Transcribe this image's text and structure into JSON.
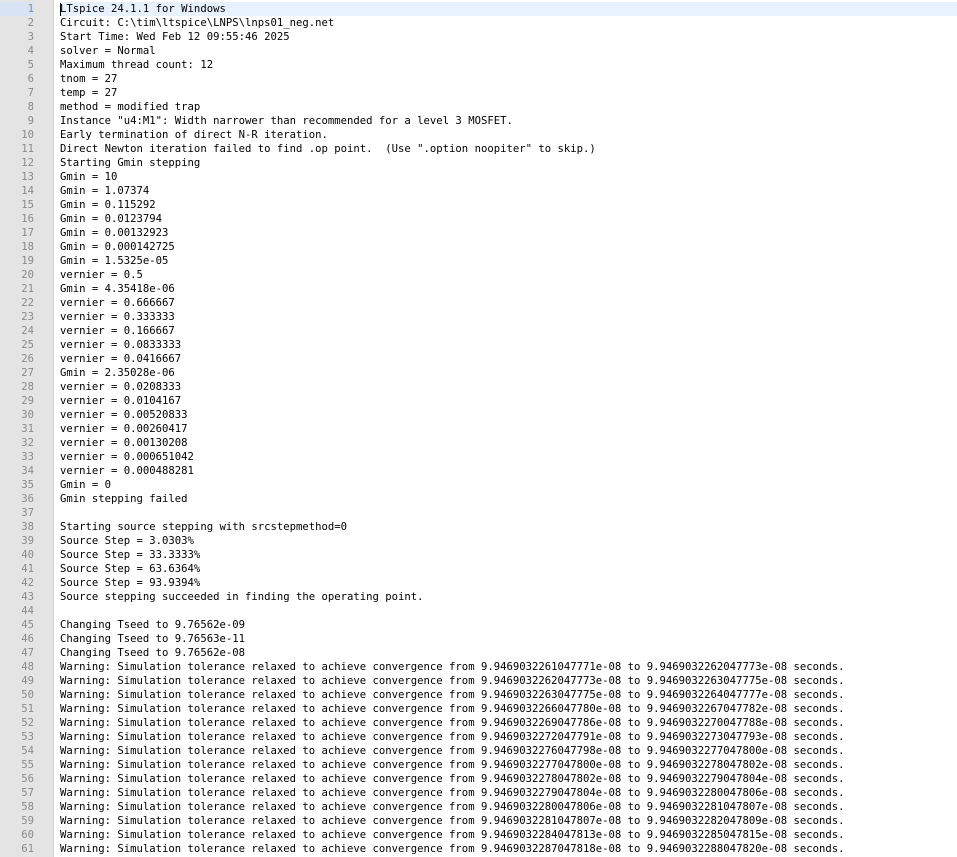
{
  "log": {
    "lines": [
      "LTspice 24.1.1 for Windows",
      "Circuit: C:\\tim\\ltspice\\LNPS\\lnps01_neg.net",
      "Start Time: Wed Feb 12 09:55:46 2025",
      "solver = Normal",
      "Maximum thread count: 12",
      "tnom = 27",
      "temp = 27",
      "method = modified trap",
      "Instance \"u4:M1\": Width narrower than recommended for a level 3 MOSFET.",
      "Early termination of direct N-R iteration.",
      "Direct Newton iteration failed to find .op point.  (Use \".option noopiter\" to skip.)",
      "Starting Gmin stepping",
      "Gmin = 10",
      "Gmin = 1.07374",
      "Gmin = 0.115292",
      "Gmin = 0.0123794",
      "Gmin = 0.00132923",
      "Gmin = 0.000142725",
      "Gmin = 1.5325e-05",
      "vernier = 0.5",
      "Gmin = 4.35418e-06",
      "vernier = 0.666667",
      "vernier = 0.333333",
      "vernier = 0.166667",
      "vernier = 0.0833333",
      "vernier = 0.0416667",
      "Gmin = 2.35028e-06",
      "vernier = 0.0208333",
      "vernier = 0.0104167",
      "vernier = 0.00520833",
      "vernier = 0.00260417",
      "vernier = 0.00130208",
      "vernier = 0.000651042",
      "vernier = 0.000488281",
      "Gmin = 0",
      "Gmin stepping failed",
      "",
      "Starting source stepping with srcstepmethod=0",
      "Source Step = 3.0303%",
      "Source Step = 33.3333%",
      "Source Step = 63.6364%",
      "Source Step = 93.9394%",
      "Source stepping succeeded in finding the operating point.",
      "",
      "Changing Tseed to 9.76562e-09",
      "Changing Tseed to 9.76563e-11",
      "Changing Tseed to 9.76562e-08",
      "Warning: Simulation tolerance relaxed to achieve convergence from 9.9469032261047771e-08 to 9.9469032262047773e-08 seconds.",
      "Warning: Simulation tolerance relaxed to achieve convergence from 9.9469032262047773e-08 to 9.9469032263047775e-08 seconds.",
      "Warning: Simulation tolerance relaxed to achieve convergence from 9.9469032263047775e-08 to 9.9469032264047777e-08 seconds.",
      "Warning: Simulation tolerance relaxed to achieve convergence from 9.9469032266047780e-08 to 9.9469032267047782e-08 seconds.",
      "Warning: Simulation tolerance relaxed to achieve convergence from 9.9469032269047786e-08 to 9.9469032270047788e-08 seconds.",
      "Warning: Simulation tolerance relaxed to achieve convergence from 9.9469032272047791e-08 to 9.9469032273047793e-08 seconds.",
      "Warning: Simulation tolerance relaxed to achieve convergence from 9.9469032276047798e-08 to 9.9469032277047800e-08 seconds.",
      "Warning: Simulation tolerance relaxed to achieve convergence from 9.9469032277047800e-08 to 9.9469032278047802e-08 seconds.",
      "Warning: Simulation tolerance relaxed to achieve convergence from 9.9469032278047802e-08 to 9.9469032279047804e-08 seconds.",
      "Warning: Simulation tolerance relaxed to achieve convergence from 9.9469032279047804e-08 to 9.9469032280047806e-08 seconds.",
      "Warning: Simulation tolerance relaxed to achieve convergence from 9.9469032280047806e-08 to 9.9469032281047807e-08 seconds.",
      "Warning: Simulation tolerance relaxed to achieve convergence from 9.9469032281047807e-08 to 9.9469032282047809e-08 seconds.",
      "Warning: Simulation tolerance relaxed to achieve convergence from 9.9469032284047813e-08 to 9.9469032285047815e-08 seconds.",
      "Warning: Simulation tolerance relaxed to achieve convergence from 9.9469032287047818e-08 to 9.9469032288047820e-08 seconds."
    ]
  },
  "colors": {
    "gutter_bg": "#e4e4e4",
    "line_number": "#8a8a8a",
    "current_line": "#e8f2fe"
  }
}
